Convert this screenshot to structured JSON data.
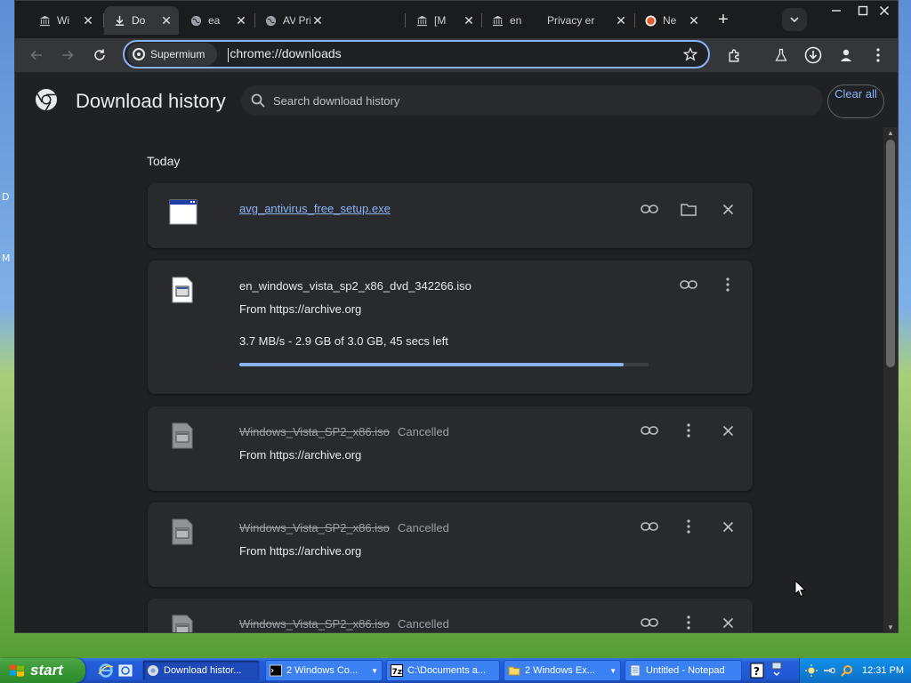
{
  "desktop": {
    "side_chars": [
      "D",
      "M"
    ]
  },
  "tabs": [
    {
      "title": "Wi",
      "icon": "museum-icon",
      "active": false
    },
    {
      "title": "Do",
      "icon": "download-icon",
      "active": true
    },
    {
      "title": "ea",
      "icon": "globe-icon",
      "active": false
    },
    {
      "title": "AV",
      "icon": "globe-icon",
      "active": false,
      "extra": "Privacy er"
    },
    {
      "title": "[M",
      "icon": "museum-icon",
      "active": false
    },
    {
      "title": "en",
      "icon": "museum-icon",
      "active": false,
      "extra": "Privacy er"
    },
    {
      "title": "Ne",
      "icon": "brave-icon",
      "active": false
    }
  ],
  "omnibox": {
    "chip_label": "Supermium",
    "url": "chrome://downloads"
  },
  "page": {
    "title": "Download history",
    "search_placeholder": "Search download history",
    "clear_all": "Clear all",
    "section_label": "Today"
  },
  "downloads": [
    {
      "name": "avg_antivirus_free_setup.exe",
      "state": "complete"
    },
    {
      "name": "en_windows_vista_sp2_x86_dvd_342266.iso",
      "state": "in_progress",
      "from": "From https://archive.org",
      "progress_text": "3.7 MB/s - 2.9 GB of 3.0 GB, 45 secs left",
      "progress": 0.94
    },
    {
      "name": "Windows_Vista_SP2_x86.iso",
      "state": "cancelled",
      "status": "Cancelled",
      "from": "From https://archive.org"
    },
    {
      "name": "Windows_Vista_SP2_x86.iso",
      "state": "cancelled",
      "status": "Cancelled",
      "from": "From https://archive.org"
    },
    {
      "name": "Windows_Vista_SP2_x86.iso",
      "state": "cancelled",
      "status": "Cancelled"
    }
  ],
  "taskbar": {
    "start_label": "start",
    "tasks": [
      {
        "label": "Download histor...",
        "icon": "chrome-icon",
        "active": true
      },
      {
        "label": "2 Windows Co...",
        "icon": "cmd-icon",
        "active": false,
        "grouped": true
      },
      {
        "label": "C:\\Documents a...",
        "icon": "7zip-icon",
        "active": false
      },
      {
        "label": "2 Windows Ex...",
        "icon": "folder-icon",
        "active": false,
        "grouped": true
      },
      {
        "label": "Untitled - Notepad",
        "icon": "notepad-icon",
        "active": false
      }
    ],
    "clock": "12:31 PM"
  }
}
